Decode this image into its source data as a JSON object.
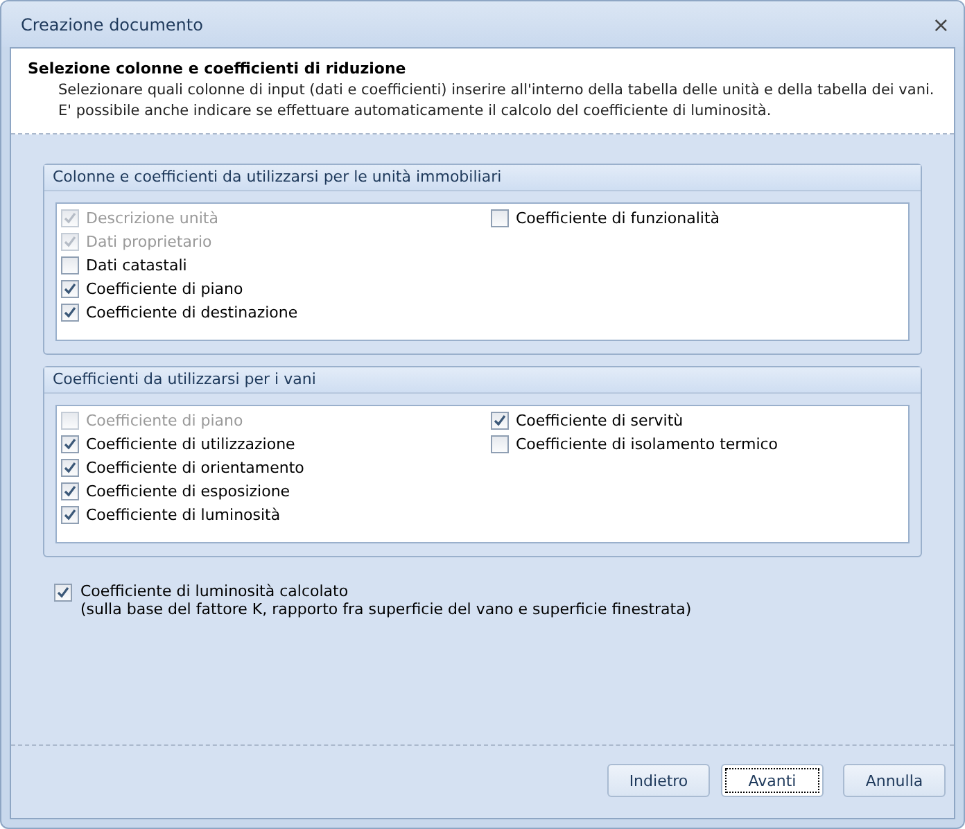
{
  "window": {
    "title": "Creazione documento",
    "close": "×"
  },
  "header": {
    "title": "Selezione colonne e coefficienti di riduzione",
    "description": "Selezionare quali colonne di input (dati e coefficienti) inserire all'interno della tabella delle unità e della tabella dei vani. E' possibile anche indicare se effettuare automaticamente il calcolo del coefficiente di luminosità."
  },
  "groups": [
    {
      "title": "Colonne e coefficienti da utilizzarsi per le unità immobiliari",
      "columns": [
        [
          {
            "label": "Descrizione unità",
            "checked": true,
            "disabled": true
          },
          {
            "label": "Dati proprietario",
            "checked": true,
            "disabled": true
          },
          {
            "label": "Dati catastali",
            "checked": false,
            "disabled": false
          },
          {
            "label": "Coefficiente di piano",
            "checked": true,
            "disabled": false
          },
          {
            "label": "Coefficiente di destinazione",
            "checked": true,
            "disabled": false
          }
        ],
        [
          {
            "label": "Coefficiente di funzionalità",
            "checked": false,
            "disabled": false
          }
        ]
      ]
    },
    {
      "title": "Coefficienti da utilizzarsi per i vani",
      "columns": [
        [
          {
            "label": "Coefficiente di piano",
            "checked": false,
            "disabled": true
          },
          {
            "label": "Coefficiente di utilizzazione",
            "checked": true,
            "disabled": false
          },
          {
            "label": "Coefficiente di orientamento",
            "checked": true,
            "disabled": false
          },
          {
            "label": "Coefficiente di esposizione",
            "checked": true,
            "disabled": false
          },
          {
            "label": "Coefficiente di luminosità",
            "checked": true,
            "disabled": false
          }
        ],
        [
          {
            "label": "Coefficiente di servitù",
            "checked": true,
            "disabled": false
          },
          {
            "label": "Coefficiente di isolamento termico",
            "checked": false,
            "disabled": false
          }
        ]
      ]
    }
  ],
  "option": {
    "label": "Coefficiente di luminosità calcolato",
    "note": "(sulla base del fattore K, rapporto fra superficie del vano e superficie finestrata)",
    "checked": true
  },
  "buttons": [
    {
      "label": "Indietro",
      "focused": false
    },
    {
      "label": "Avanti",
      "focused": true
    },
    {
      "label": "Annulla",
      "focused": false
    }
  ]
}
